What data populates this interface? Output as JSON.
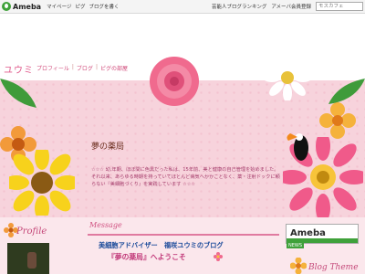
{
  "topbar": {
    "logo_text": "Ameba",
    "links": [
      "マイページ",
      "ピグ",
      "ブログを書く"
    ],
    "right_links": [
      "芸能人ブログランキング",
      "アメーバ会員登録"
    ],
    "search_placeholder": "モスカフェ"
  },
  "blog": {
    "title": "ユウミ",
    "nav": [
      "プロフィール",
      "ブログ",
      "ピグの部屋"
    ],
    "header_title": "夢の薬局",
    "description": "☆☆☆ 幼,年期、ほぼ間に色黒だった私は、15年前、美と健康の自己管理を始めました。それ以来、あらゆる時期を持っていてほとんど病気へかかことなく、薬・注射ドックに頼らない『美細胞づくり』を実践しています ☆☆☆"
  },
  "sidebar": {
    "profile_label": "Profile"
  },
  "main": {
    "message_label": "Message",
    "line1": "美細胞アドバイザー　福咲ユウミのブログ",
    "line2": "『夢の薬局』へようこそ"
  },
  "right": {
    "ameba_banner": "Ameba",
    "news": "NEWS",
    "blog_theme": "Blog Theme"
  },
  "colors": {
    "accent": "#e0588a",
    "header_bg": "#f7d3dc",
    "ameba_green": "#3fa13a"
  }
}
